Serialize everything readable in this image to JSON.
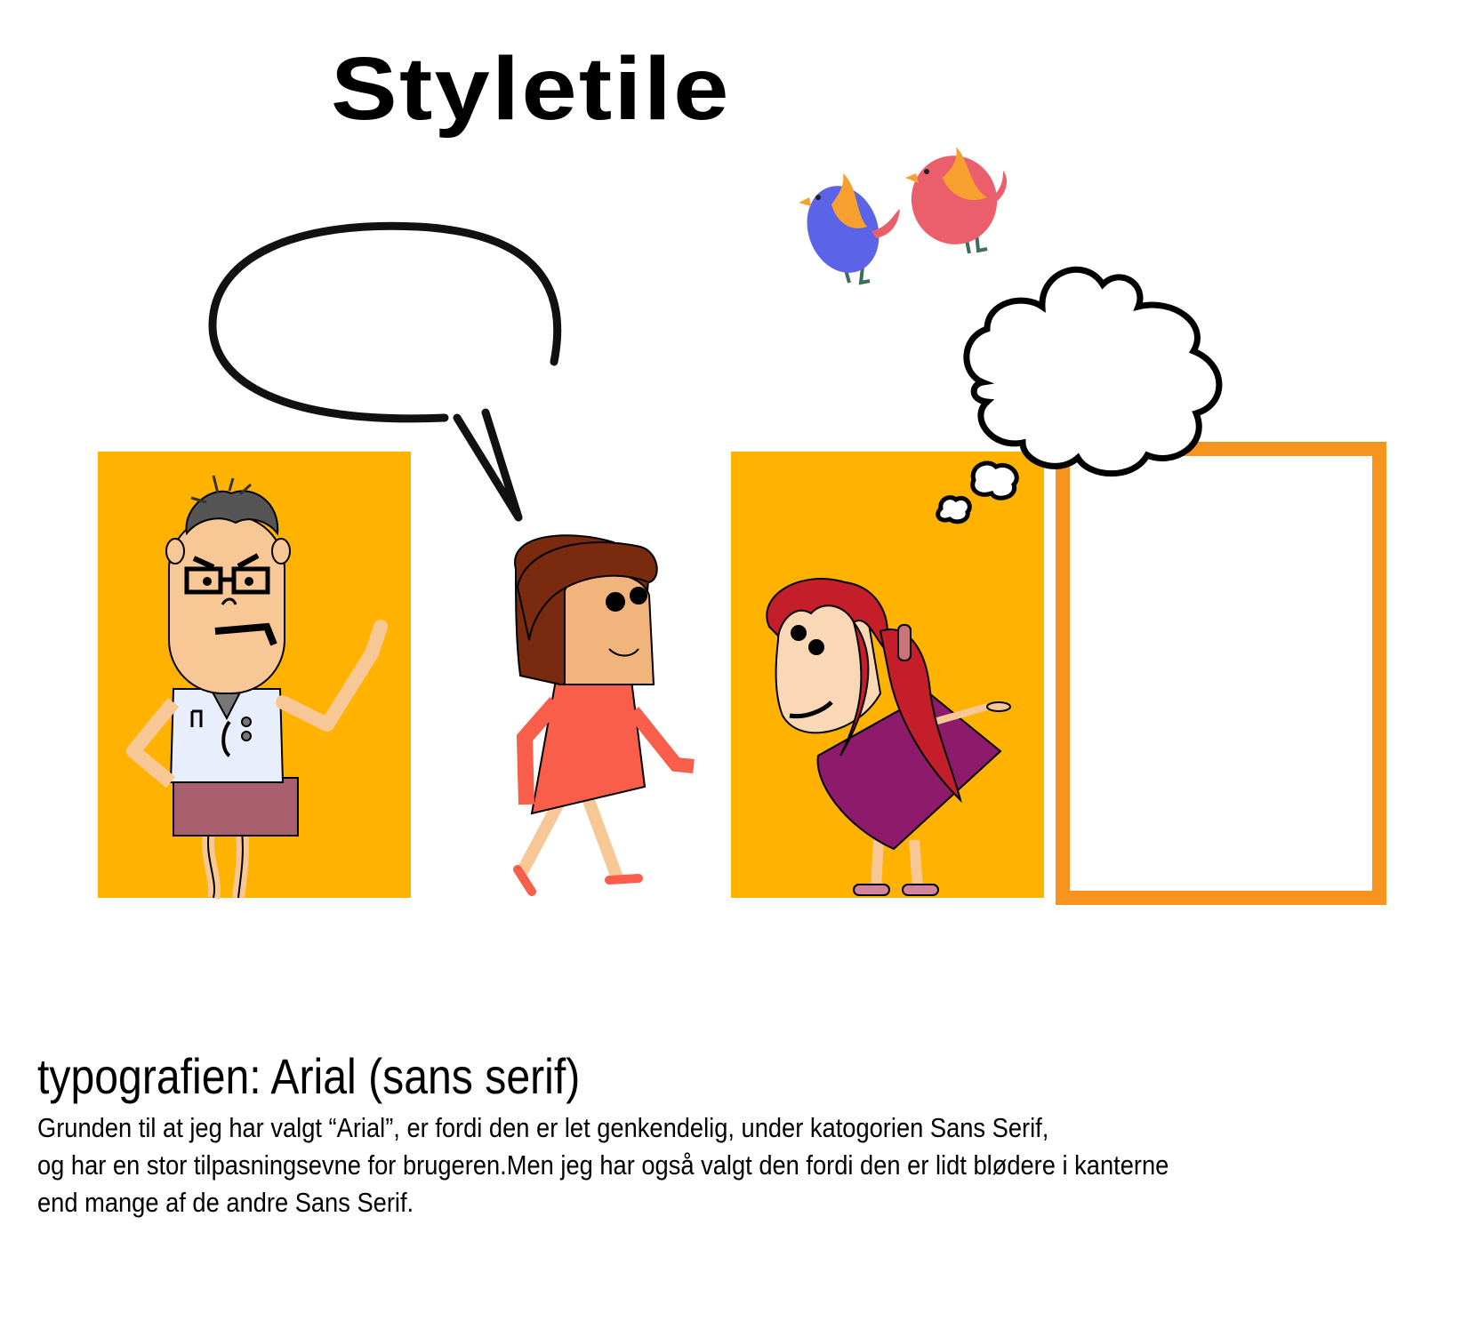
{
  "title": "Styletile",
  "section": {
    "heading": "typografien: Arial (sans serif)",
    "lines": [
      "Grunden til at jeg har valgt “Arial”, er fordi den er let genkendelig, under katogorien Sans Serif,",
      "og har en stor tilpasningsevne for brugeren.Men jeg har også valgt den fordi den er lidt blødere i kanterne",
      "end mange af de andre Sans Serif."
    ]
  },
  "colors": {
    "panel_yellow": "#FFB300",
    "frame_orange": "#F7941D",
    "bird_blue": "#5B63E6",
    "bird_red": "#EB5E6B",
    "bird_wing": "#F7A030",
    "skin": "#F7C895",
    "girl_dress": "#F95E4B",
    "girl_hair": "#7A2A0E",
    "redhead_hair": "#C41E2A",
    "purple_dress": "#8E1A6B",
    "shorts": "#A8606F",
    "shirt": "#E8EEFB"
  },
  "icons": [
    "speech-bubble-icon",
    "thought-cloud-icon",
    "blue-bird-icon",
    "red-bird-icon"
  ]
}
